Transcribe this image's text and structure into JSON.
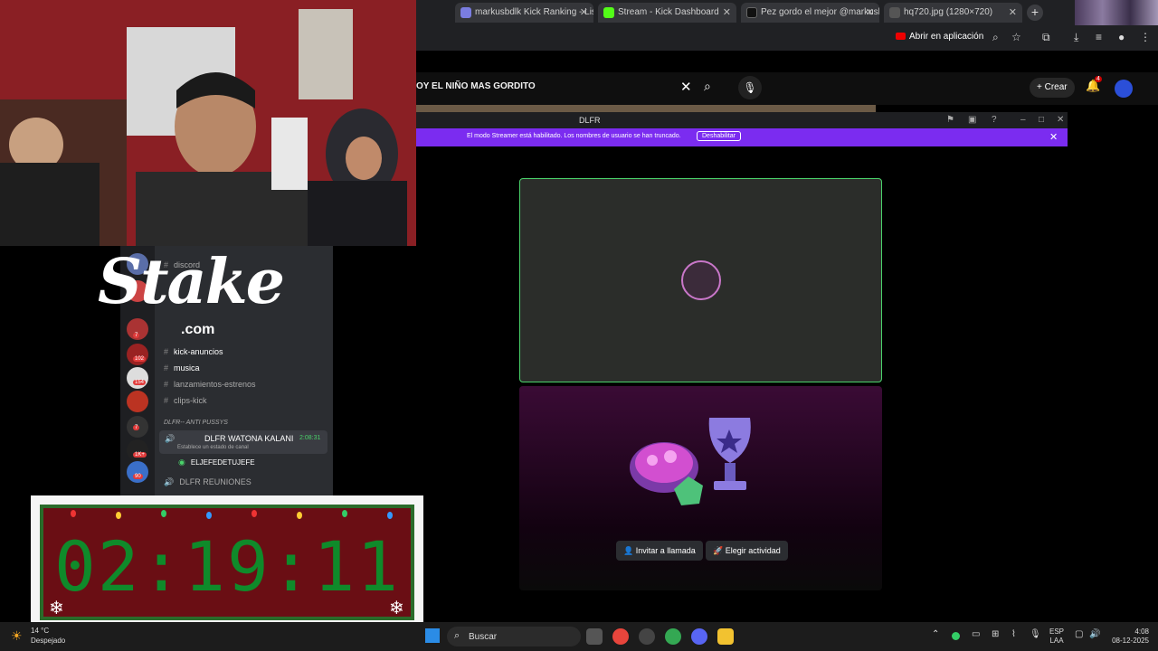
{
  "tabs": [
    {
      "label": "markusbdlk Kick Ranking - List",
      "color": "#7a7de0"
    },
    {
      "label": "Stream - Kick Dashboard",
      "color": "#53fc18"
    },
    {
      "label": "Pez gordo el mejor @markush",
      "color": "#111111"
    },
    {
      "label": "hq720.jpg (1280×720)",
      "color": "#555555"
    }
  ],
  "toolbar": {
    "open_app_label": "Abrir en aplicación"
  },
  "youtube": {
    "search_value": "OY EL NIÑO MAS GORDITO",
    "create_label": "Crear",
    "notification_count": "4"
  },
  "discord": {
    "window_title": "DLFR",
    "streamer_notice": "El modo Streamer está habilitado. Los nombres de usuario se han truncado.",
    "streamer_disable_label": "Deshabilitar",
    "invite_label": "Invitar a llamada",
    "activity_label": "Elegir actividad",
    "channels": {
      "discord": "discord",
      "kick_announcements": "kick-anuncios",
      "music": "musica",
      "releases": "lanzamientos-estrenos",
      "clips": "clips-kick",
      "category": "DLFR-- ANTI PUSSYS",
      "voice_active": "DLFR WATONA KALANI",
      "voice_time": "2:08:31",
      "voice_status": "Establece un estado de canal",
      "user": "ELJEFEDETUJEFE",
      "meetings": "DLFR REUNIONES"
    },
    "server_badges": [
      "7",
      "102",
      "154",
      "7",
      "1K+",
      "90"
    ]
  },
  "stake": {
    "word": "Stake",
    "domain": ".com"
  },
  "timer": {
    "value": "02:19:11"
  },
  "taskbar": {
    "weather_temp": "14 °C",
    "weather_desc": "Despejado",
    "search_placeholder": "Buscar",
    "lang_line1": "ESP",
    "lang_line2": "LAA",
    "time": "4:08",
    "date": "08-12-2025"
  }
}
